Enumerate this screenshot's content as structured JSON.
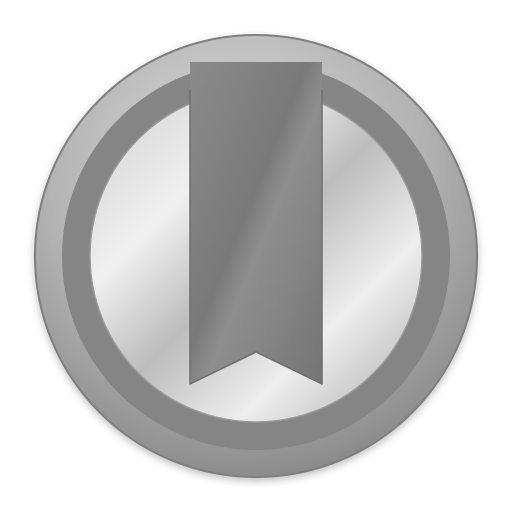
{
  "icon": {
    "name": "bookmark-icon",
    "colors": {
      "background": "#ffffff",
      "outer_rim_light": "#c4c4c4",
      "outer_rim_dark": "#8d8d8d",
      "ring": "#858585",
      "face_light": "#e6e6e6",
      "face_mid": "#bdbdbd",
      "face_dark": "#9e9e9e",
      "ribbon": "#7e7e7e",
      "ribbon_edge": "#6a6a6a"
    }
  }
}
